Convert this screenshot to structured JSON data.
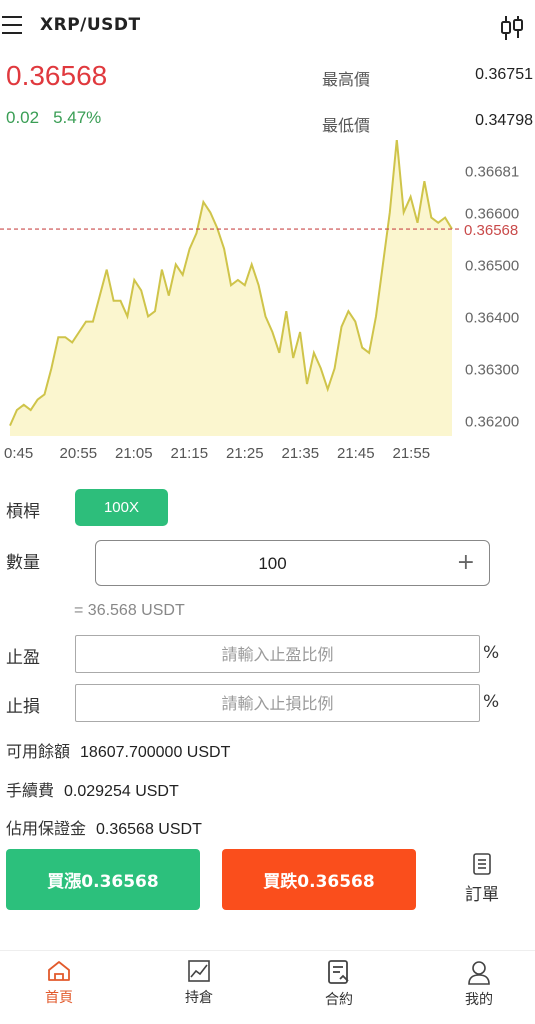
{
  "header": {
    "pair": "XRP/USDT",
    "menu_icon": "hamburger-menu-icon",
    "chart_icon": "candlestick-icon"
  },
  "ticker": {
    "price": "0.36568",
    "change": "0.02",
    "change_pct": "5.47%",
    "high_label": "最高價",
    "high_value": "0.36751",
    "low_label": "最低價",
    "low_value": "0.34798"
  },
  "chart_data": {
    "type": "area",
    "x_ticks": [
      "0:45",
      "20:55",
      "21:05",
      "21:15",
      "21:25",
      "21:35",
      "21:45",
      "21:55"
    ],
    "y_ticks": [
      "0.36681",
      "0.36600",
      "0.36500",
      "0.36400",
      "0.36300",
      "0.36200"
    ],
    "current_price_label": "0.36568",
    "ylim": [
      0.3617,
      0.3672
    ],
    "line_color": "#cfc44a",
    "fill_color": "#fbf6cf",
    "ref_line_color": "#c94a4a",
    "values": [
      0.3619,
      0.3622,
      0.3623,
      0.3622,
      0.3624,
      0.3625,
      0.363,
      0.3636,
      0.3636,
      0.3635,
      0.3637,
      0.3639,
      0.3639,
      0.3644,
      0.3649,
      0.3643,
      0.3643,
      0.364,
      0.3647,
      0.3645,
      0.364,
      0.3641,
      0.3649,
      0.3644,
      0.365,
      0.3648,
      0.3653,
      0.3656,
      0.3662,
      0.366,
      0.3657,
      0.3653,
      0.3646,
      0.3647,
      0.3646,
      0.365,
      0.3646,
      0.364,
      0.3637,
      0.3633,
      0.3641,
      0.3632,
      0.3637,
      0.3627,
      0.3633,
      0.363,
      0.3626,
      0.363,
      0.3638,
      0.3641,
      0.3639,
      0.3634,
      0.3633,
      0.364,
      0.365,
      0.366,
      0.3674,
      0.366,
      0.3663,
      0.3658,
      0.3666,
      0.3659,
      0.3658,
      0.3659,
      0.36568
    ]
  },
  "form": {
    "leverage_label": "槓桿",
    "leverage_value": "100X",
    "qty_label": "數量",
    "qty_value": "100",
    "qty_plus": "+",
    "qty_approx": "= 36.568 USDT",
    "tp_label": "止盈",
    "tp_placeholder": "請輸入止盈比例",
    "sl_label": "止損",
    "sl_placeholder": "請輸入止損比例",
    "pct": "%"
  },
  "info": {
    "balance_label": "可用餘額",
    "balance_value": "18607.700000 USDT",
    "fee_label": "手續費",
    "fee_value": "0.029254 USDT",
    "margin_label": "佔用保證金",
    "margin_value": "0.36568 USDT"
  },
  "actions": {
    "buy_label": "買漲0.36568",
    "sell_label": "買跌0.36568",
    "orders_label": "訂單",
    "buy_color": "#2cc07c",
    "sell_color": "#fa4e1c"
  },
  "nav": [
    {
      "label": "首頁",
      "icon": "home-icon",
      "active": true
    },
    {
      "label": "持倉",
      "icon": "trend-chart-icon",
      "active": false
    },
    {
      "label": "合約",
      "icon": "contract-icon",
      "active": false
    },
    {
      "label": "我的",
      "icon": "user-icon",
      "active": false
    }
  ]
}
